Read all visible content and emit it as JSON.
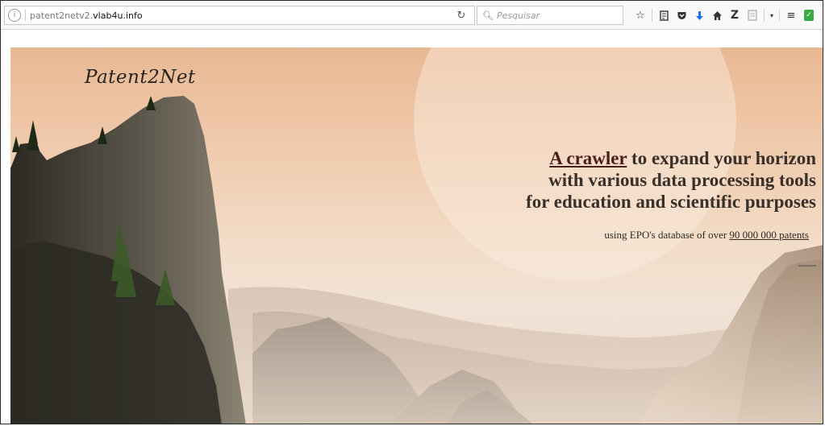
{
  "browser": {
    "url_host": "patent2netv2.",
    "url_domain": "vlab4u.info",
    "info_icon": "info-icon",
    "reload_icon": "reload-icon",
    "search_placeholder": "Pesquisar",
    "toolbar_icons": [
      "star-icon",
      "reading-list-icon",
      "pocket-icon",
      "download-icon",
      "home-icon",
      "zotero-icon",
      "page-icon",
      "dropdown-icon",
      "menu-icon",
      "extension-icon"
    ]
  },
  "page": {
    "logo": "Patent2Net",
    "headline": {
      "link_text": "A crawler",
      "line1_rest": " to expand your horizon",
      "line2": "with various data processing tools",
      "line3": "for education and scientific purposes"
    },
    "subline": {
      "prefix": "using EPO's database of over ",
      "count_link": "90 000 000 patents"
    }
  },
  "colors": {
    "sky_top": "#e9b893",
    "headline_text": "#3a302a",
    "link_text": "#4a1f18",
    "download_arrow": "#1a73e8",
    "extension_green": "#3aa845"
  }
}
